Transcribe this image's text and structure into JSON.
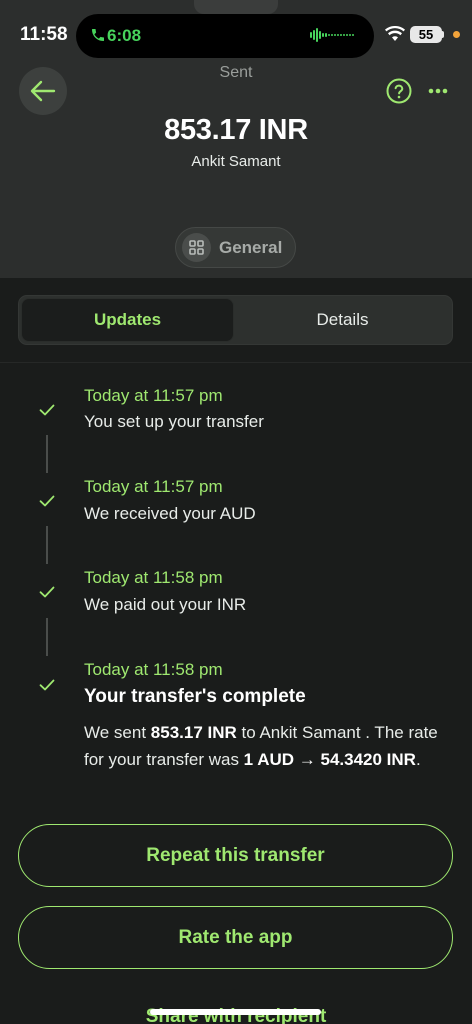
{
  "status_bar": {
    "time": "11:58",
    "call_time": "6:08",
    "battery": "55"
  },
  "header": {
    "state": "Sent",
    "amount": "853.17 INR",
    "recipient": "Ankit Samant",
    "category": "General"
  },
  "tabs": [
    {
      "label": "Updates",
      "active": true
    },
    {
      "label": "Details",
      "active": false
    }
  ],
  "timeline": [
    {
      "time": "Today at 11:57 pm",
      "text": "You set up your transfer"
    },
    {
      "time": "Today at 11:57 pm",
      "text": "We received your AUD"
    },
    {
      "time": "Today at 11:58 pm",
      "text": "We paid out your INR"
    },
    {
      "time": "Today at 11:58 pm",
      "title": "Your transfer's complete",
      "desc": {
        "p1": "We sent ",
        "amount": "853.17 INR",
        "p2": " to Ankit Samant . The rate for your transfer was ",
        "rate": "1 AUD → 54.3420 INR",
        "p3": "."
      }
    }
  ],
  "actions": {
    "repeat": "Repeat this transfer",
    "rate": "Rate the app",
    "share": "Share with recipient"
  },
  "colors": {
    "accent": "#9fe870",
    "call_green": "#47d45c",
    "background": "#1a1c1b",
    "header_bg": "#2c2e2d"
  },
  "icons": [
    "phone-icon",
    "audio-wave-icon",
    "wifi-icon",
    "back-arrow-icon",
    "help-icon",
    "more-icon",
    "grid-icon",
    "check-icon"
  ]
}
